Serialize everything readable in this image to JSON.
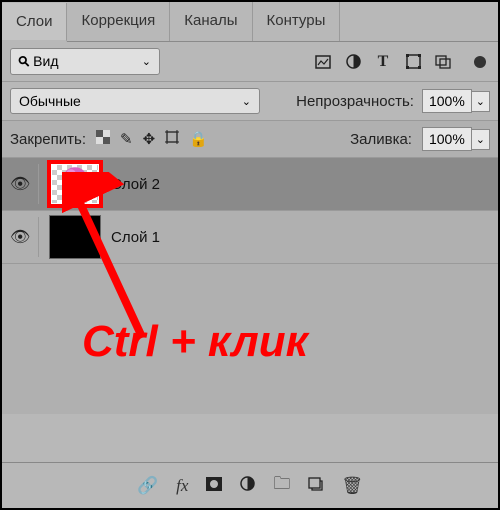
{
  "tabs": {
    "layers": "Слои",
    "correction": "Коррекция",
    "channels": "Каналы",
    "paths": "Контуры"
  },
  "view_dropdown": "Вид",
  "blend_mode": "Обычные",
  "opacity_label": "Непрозрачность:",
  "opacity_value": "100%",
  "lock_label": "Закрепить:",
  "fill_label": "Заливка:",
  "fill_value": "100%",
  "layers": [
    {
      "name": "Слой 2",
      "selected": true,
      "highlighted": true,
      "thumb": "flower"
    },
    {
      "name": "Слой 1",
      "selected": false,
      "highlighted": false,
      "thumb": "black"
    }
  ],
  "annotation": "Ctrl + клик",
  "icons": {
    "search": "⚲",
    "image": "▢",
    "circle_half": "◐",
    "text": "T",
    "transform": "◫",
    "artboard": "⧉",
    "pixel": "⊞",
    "brush": "✎",
    "move": "✥",
    "crop": "⟐",
    "lock": "🔒",
    "link": "⧉",
    "fx": "fx",
    "mask": "◼",
    "adjust": "◐",
    "group": "🗀",
    "new": "⧉",
    "trash": "🗑"
  }
}
